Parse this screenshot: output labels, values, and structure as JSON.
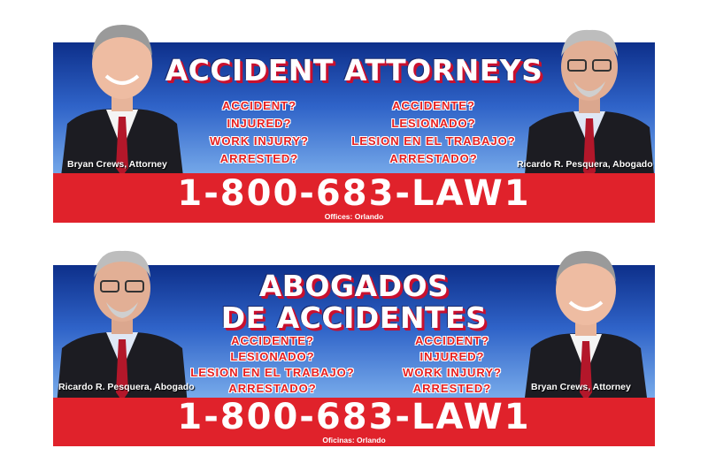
{
  "billboard_top": {
    "title": "ACCIDENT ATTORNEYS",
    "questions_left": [
      "ACCIDENT?",
      "INJURED?",
      "WORK INJURY?",
      "ARRESTED?"
    ],
    "questions_right": [
      "ACCIDENTE?",
      "LESIONADO?",
      "LESION EN EL TRABAJO?",
      "ARRESTADO?"
    ],
    "left_caption": "Bryan Crews, Attorney",
    "right_caption": "Ricardo R. Pesquera, Abogado",
    "phone": "1-800-683-LAW1",
    "offices": "Offices: Orlando"
  },
  "billboard_bottom": {
    "title_line1": "ABOGADOS",
    "title_line2": "DE ACCIDENTES",
    "questions_left": [
      "ACCIDENTE?",
      "LESIONADO?",
      "LESION EN EL TRABAJO?",
      "ARRESTADO?"
    ],
    "questions_right": [
      "ACCIDENT?",
      "INJURED?",
      "WORK INJURY?",
      "ARRESTED?"
    ],
    "left_caption": "Ricardo R. Pesquera, Abogado",
    "right_caption": "Bryan Crews, Attorney",
    "phone": "1-800-683-LAW1",
    "offices": "Oficinas: Orlando"
  },
  "colors": {
    "sky_top": "#0d2f8a",
    "sky_bottom": "#7fb2ee",
    "red": "#e0222b",
    "question_red": "#e62020"
  }
}
